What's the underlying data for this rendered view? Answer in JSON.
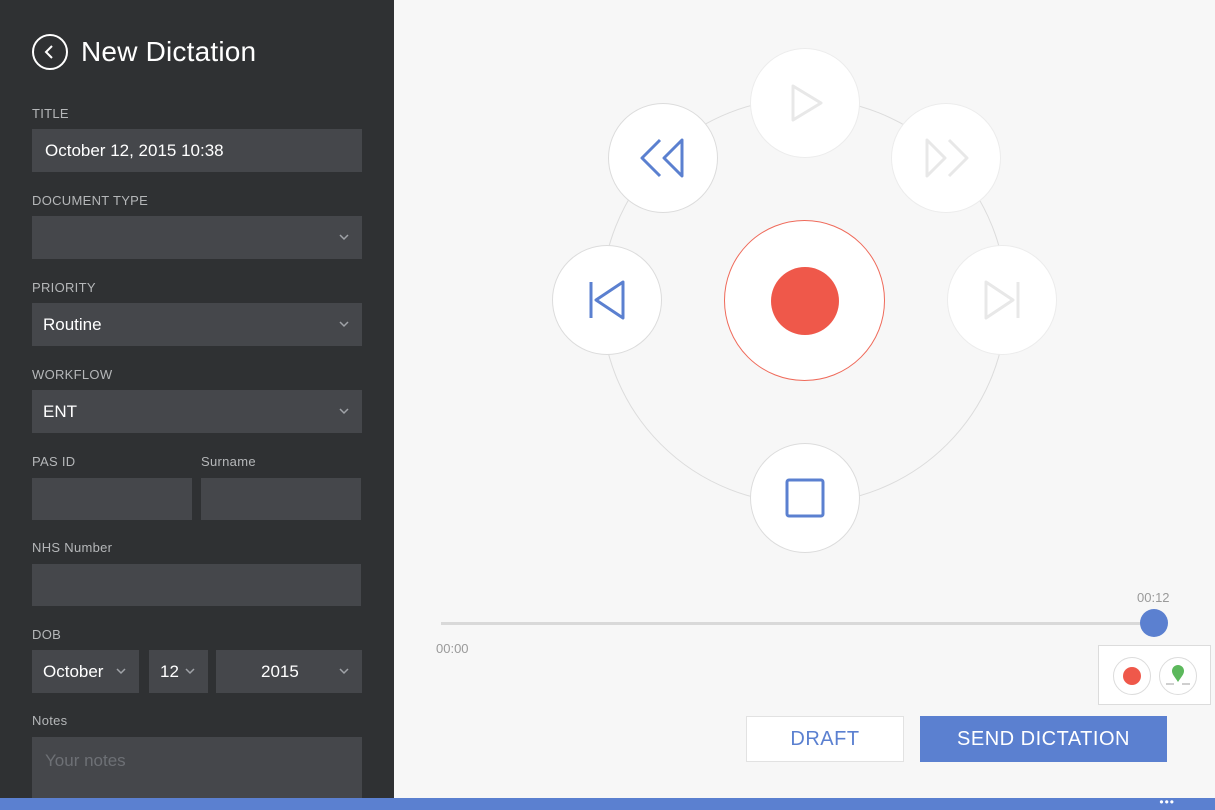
{
  "header": {
    "title": "New Dictation"
  },
  "form": {
    "title_label": "TITLE",
    "title_value": "October 12, 2015 10:38",
    "doctype_label": "DOCUMENT TYPE",
    "doctype_value": "",
    "priority_label": "PRIORITY",
    "priority_value": "Routine",
    "workflow_label": "WORKFLOW",
    "workflow_value": "ENT",
    "pasid_label": "PAS ID",
    "pasid_value": "",
    "surname_label": "Surname",
    "surname_value": "",
    "nhs_label": "NHS Number",
    "nhs_value": "",
    "dob_label": "DOB",
    "dob_month": "October",
    "dob_day": "12",
    "dob_year": "2015",
    "notes_label": "Notes",
    "notes_placeholder": "Your notes"
  },
  "player": {
    "current_time": "00:12",
    "start_time": "00:00",
    "progress": 1.0,
    "icons": [
      "play-icon",
      "rewind-icon",
      "fast-forward-icon",
      "skip-back-icon",
      "skip-forward-icon",
      "record-icon",
      "stop-icon",
      "marker-icon"
    ]
  },
  "actions": {
    "draft_label": "DRAFT",
    "send_label": "SEND DICTATION"
  },
  "colors": {
    "accent": "#5b80d0",
    "record": "#ef584a",
    "sidebar": "#2f3133",
    "field": "#45474b",
    "marker": "#5cb85c"
  }
}
